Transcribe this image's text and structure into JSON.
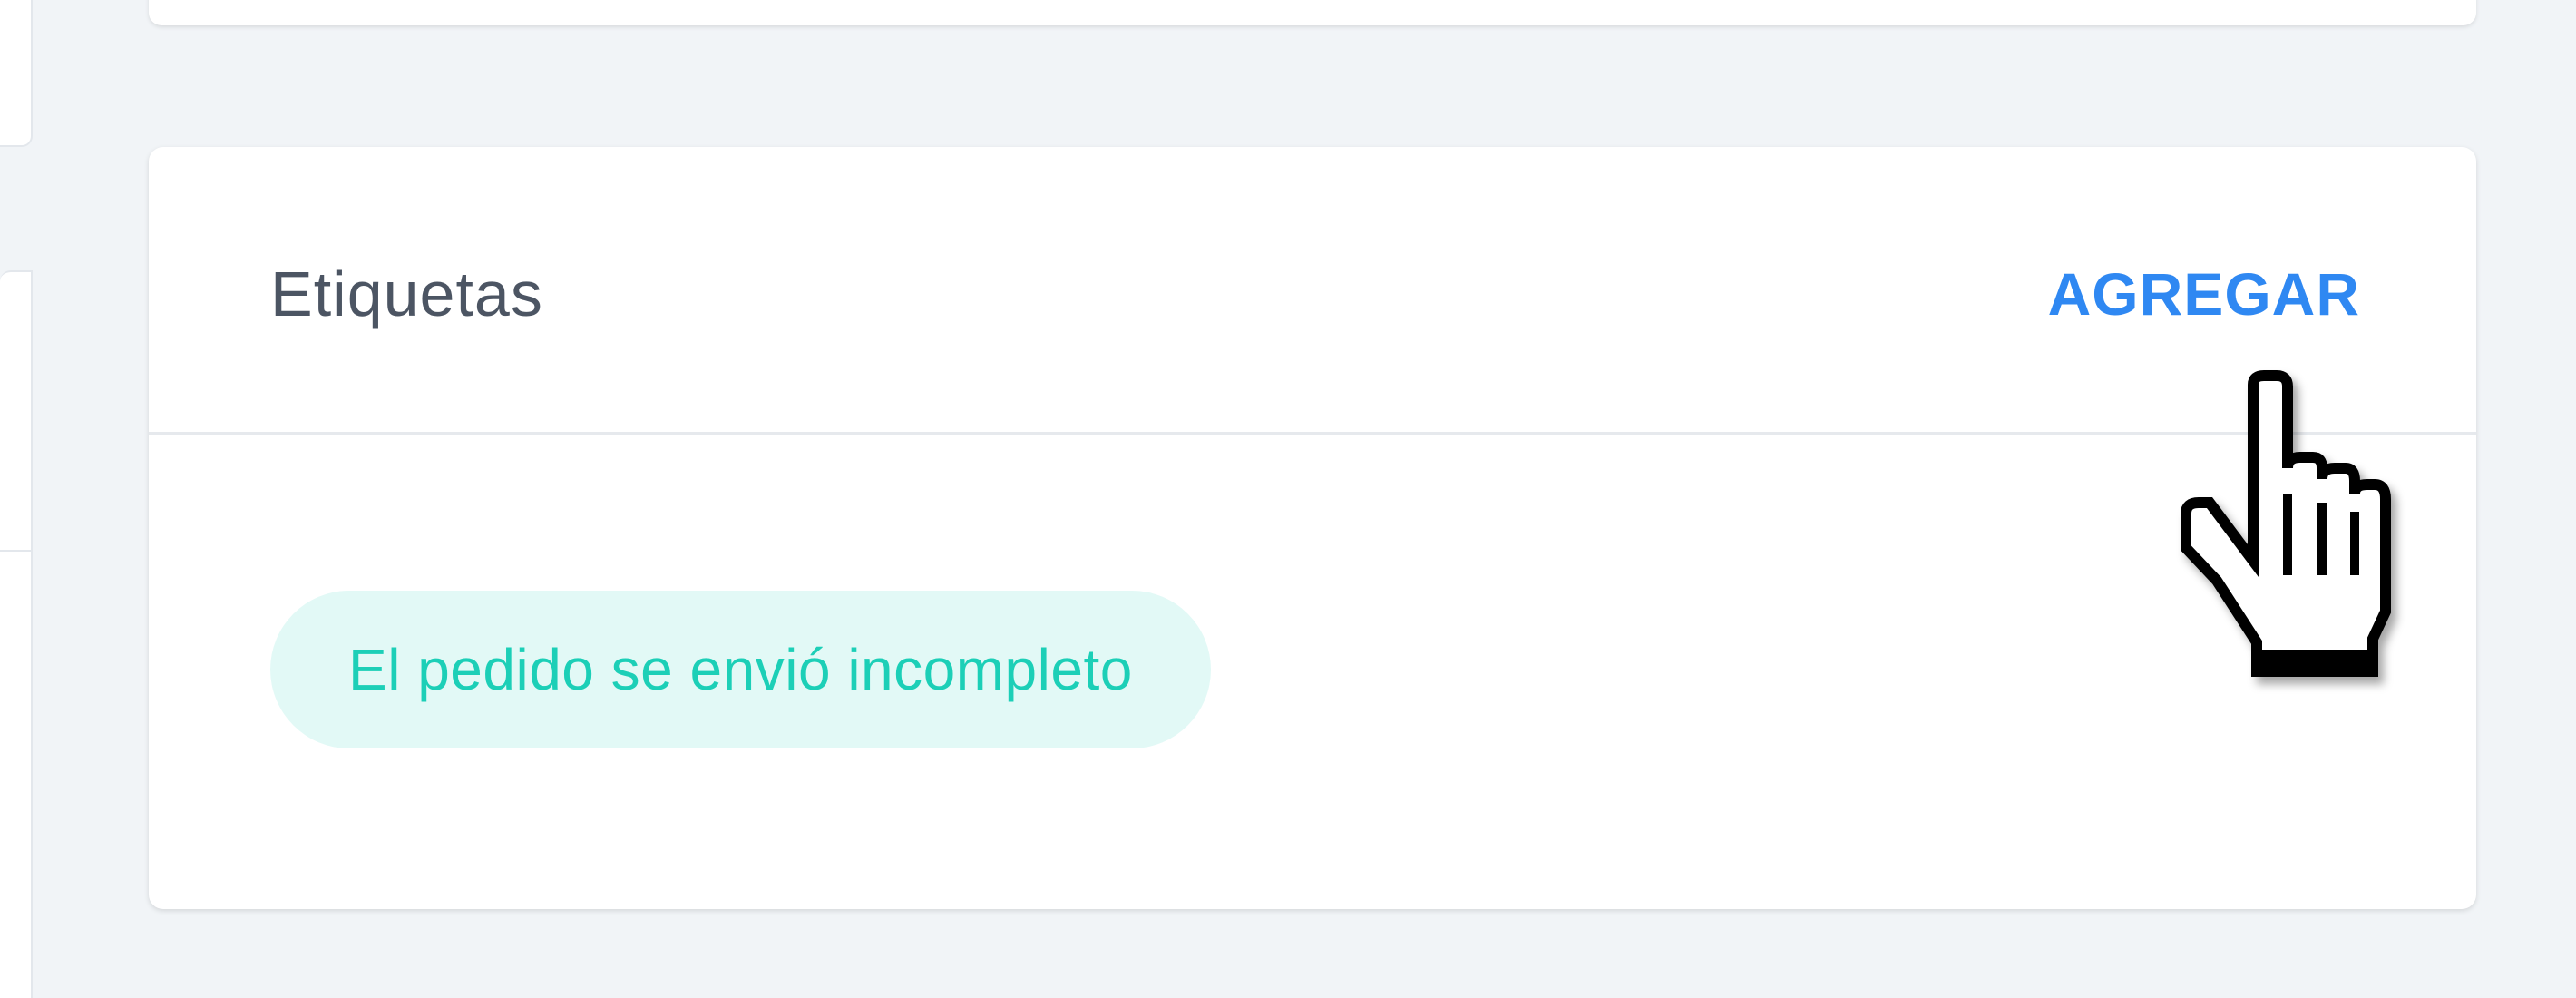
{
  "tags_card": {
    "title": "Etiquetas",
    "add_label": "AGREGAR",
    "tags": [
      {
        "label": "El pedido se envió incompleto"
      }
    ]
  },
  "colors": {
    "background": "#f1f4f7",
    "card": "#ffffff",
    "title_text": "#4c5563",
    "accent_blue": "#2f88f2",
    "tag_text": "#1ccfb7",
    "tag_background": "#e2f9f6"
  },
  "cursor": {
    "icon": "hand-pointer-icon"
  }
}
